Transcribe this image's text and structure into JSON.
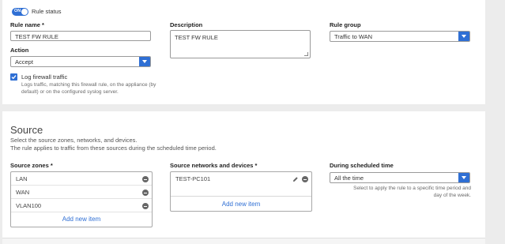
{
  "rule_status": {
    "toggle_text": "ON",
    "label": "Rule status"
  },
  "rule_name": {
    "label": "Rule name *",
    "value": "TEST FW RULE"
  },
  "description": {
    "label": "Description",
    "value": "TEST FW RULE"
  },
  "rule_group": {
    "label": "Rule group",
    "value": "Traffic to WAN"
  },
  "action": {
    "label": "Action",
    "value": "Accept"
  },
  "log_traffic": {
    "label": "Log firewall traffic",
    "checked": true,
    "help_line1": "Logs traffic, matching this firewall rule, on the appliance (by",
    "help_line2": "default) or on the configured syslog server."
  },
  "source": {
    "heading": "Source",
    "desc_line1": "Select the source zones, networks, and devices.",
    "desc_line2": "The rule applies to traffic from these sources during the scheduled time period.",
    "zones": {
      "label": "Source zones *",
      "items": [
        "LAN",
        "WAN",
        "VLAN100"
      ],
      "add_label": "Add new item"
    },
    "networks": {
      "label": "Source networks and devices *",
      "items": [
        "TEST-PC101"
      ],
      "add_label": "Add new item"
    },
    "schedule": {
      "label": "During scheduled time",
      "value": "All the time",
      "help_line1": "Select to apply the rule to a specific time period and",
      "help_line2": "day of the week."
    }
  },
  "colors": {
    "accent": "#2f6fd4",
    "panel": "#ffffff",
    "background": "#ececec"
  }
}
